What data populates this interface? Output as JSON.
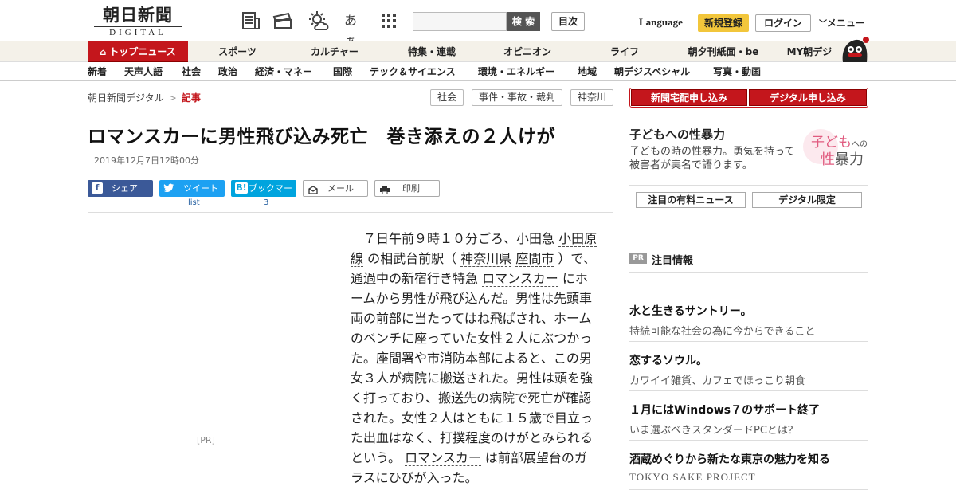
{
  "header": {
    "logo_ja": "朝日新聞",
    "logo_en": "DIGITAL",
    "search_button": "検 索",
    "toc_button": "目次",
    "language": "Language",
    "register": "新規登録",
    "login": "ログイン",
    "menu": "メニュー",
    "font_size_icon_text": "あぁ"
  },
  "global_nav": [
    "トップニュース",
    "スポーツ",
    "カルチャー",
    "特集・連載",
    "オピニオン",
    "ライフ",
    "朝夕刊紙面・be",
    "MY朝デジ"
  ],
  "sub_nav": [
    "新着",
    "天声人語",
    "社会",
    "政治",
    "経済・マネー",
    "国際",
    "テック＆サイエンス",
    "環境・エネルギー",
    "地域",
    "朝デジスペシャル",
    "写真・動画"
  ],
  "breadcrumb": {
    "root": "朝日新聞デジタル",
    "sep": ">",
    "current": "記事"
  },
  "tags": [
    "社会",
    "事件・事故・裁判",
    "神奈川"
  ],
  "article": {
    "title": "ロマンスカーに男性飛び込み死亡　巻き添えの２人けが",
    "date": "2019年12月7日12時00分",
    "body": {
      "p1": "７日午前９時１０分ごろ、小田急 ",
      "l1": "小田原線",
      "p2": " の相武台前駅（ ",
      "l2": "神奈川県",
      "p3": "  ",
      "l3": "座間市",
      "p4": " ）で、通過中の新宿行き特急 ",
      "l4": "ロマンスカー",
      "p5": " にホームから男性が飛び込んだ。男性は先頭車両の前部に当たってはね飛ばされ、ホームのベンチに座っていた女性２人にぶつかった。座間署や市消防本部によると、この男女３人が病院に搬送された。男性は頭を強く打っており、搬送先の病院で死亡が確認された。女性２人はともに１５歳で目立った出血はなく、打撲程度のけがとみられるという。 ",
      "l5": "ロマンスカー",
      "p6": " は前部展望台のガラスにひびが入った。"
    },
    "pr_label": "[PR]"
  },
  "share": {
    "facebook": "シェア",
    "twitter": "ツイート",
    "twitter_count": "list",
    "hatena_icon": "B!",
    "hatena": "ブックマーク",
    "hatena_count": "3",
    "mail": "メール",
    "print": "印刷"
  },
  "sidebar": {
    "subscribe_paper": "新聞宅配申し込み",
    "subscribe_digital": "デジタル申し込み",
    "feature": {
      "title": "子どもへの性暴力",
      "desc": "子どもの時の性暴力。勇気を持って被害者が実名で語ります。",
      "logo_line1": "子ども",
      "logo_small": "への",
      "logo_line2a": "性",
      "logo_line2b": "暴力"
    },
    "btn_paid": "注目の有料ニュース",
    "btn_digital": "デジタル限定",
    "pr_badge": "PR",
    "pr_heading": "注目情報",
    "pr_items": [
      {
        "title": "水と生きるサントリー。",
        "desc": "持続可能な社会の為に今からできること"
      },
      {
        "title": "恋するソウル。",
        "desc": "カワイイ雑貨、カフェでほっこり朝食"
      },
      {
        "title": "１月にはWindows７のサポート終了",
        "desc": "いま選ぶべきスタンダードPCとは？"
      },
      {
        "title": "酒蔵めぐりから新たな東京の魅力を知る",
        "desc": "TOKYO SAKE PROJECT"
      }
    ]
  },
  "colors": {
    "brand_red": "#c4161c",
    "register_yellow": "#f2c63b",
    "facebook": "#3b5998",
    "twitter": "#1da1f2",
    "hatena": "#00a4de"
  }
}
